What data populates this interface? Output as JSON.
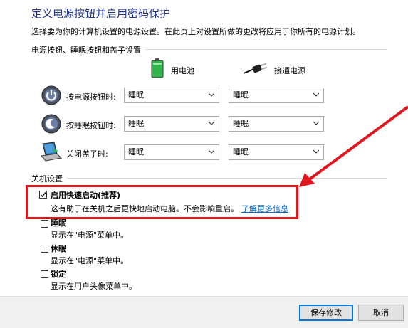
{
  "header": {
    "title": "定义电源按钮并启用密码保护",
    "subtitle": "选择要为你的计算机设置的电源设置。在此页上对设置所做的更改将应用于你所有的电源计划。"
  },
  "power_section": {
    "label": "电源按钮、睡眠按钮和盖子设置",
    "columns": {
      "battery": "用电池",
      "plugged": "接通电源"
    },
    "rows": [
      {
        "label": "按电源按钮时:",
        "battery": "睡眠",
        "plugged": "睡眠",
        "icon": "power-button-icon"
      },
      {
        "label": "按睡眠按钮时:",
        "battery": "睡眠",
        "plugged": "睡眠",
        "icon": "sleep-button-icon"
      },
      {
        "label": "关闭盖子时:",
        "battery": "睡眠",
        "plugged": "睡眠",
        "icon": "laptop-lid-icon"
      }
    ]
  },
  "shutdown_section": {
    "label": "关机设置",
    "items": [
      {
        "label": "启用快速启动(推荐)",
        "checked": true,
        "desc": "这有助于在关机之后更快地启动电脑。不会影响重启。",
        "link": "了解更多信息"
      },
      {
        "label": "睡眠",
        "checked": false,
        "desc": "显示在\"电源\"菜单中。"
      },
      {
        "label": "休眠",
        "checked": false,
        "desc": "显示在\"电源\"菜单中。"
      },
      {
        "label": "锁定",
        "checked": false,
        "desc": "显示在用户头像菜单中。"
      }
    ]
  },
  "footer": {
    "save": "保存修改",
    "cancel": "取消"
  },
  "colors": {
    "title": "#1e3287",
    "link": "#0066cc",
    "annotation": "#e0171d",
    "battery": "#2fb34a"
  }
}
